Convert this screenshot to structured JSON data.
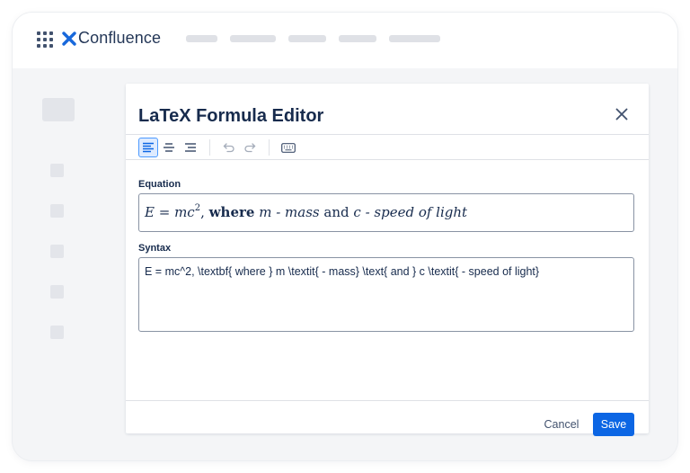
{
  "app": {
    "brand": "Confluence",
    "brand_color": "#1868db"
  },
  "dialog": {
    "title": "LaTeX Formula Editor",
    "toolbar": {
      "align_left": "align-left-icon",
      "align_center": "align-center-icon",
      "align_right": "align-right-icon",
      "undo": "undo-icon",
      "redo": "redo-icon",
      "keyboard": "keyboard-icon"
    },
    "equation": {
      "label": "Equation",
      "lhs": "E",
      "eq": " = ",
      "m1": "m",
      "c1": "c",
      "exp": "2",
      "comma": ",  ",
      "where": "where",
      "m2": "m",
      "mass": " - mass ",
      "and": "and",
      "c2": "c",
      "speed": " - speed of light"
    },
    "syntax": {
      "label": "Syntax",
      "value": "E = mc^2, \\textbf{ where } m \\textit{ - mass} \\text{ and } c \\textit{ - speed of light}"
    },
    "cancel_label": "Cancel",
    "save_label": "Save",
    "accent_color": "#0c66e4"
  }
}
